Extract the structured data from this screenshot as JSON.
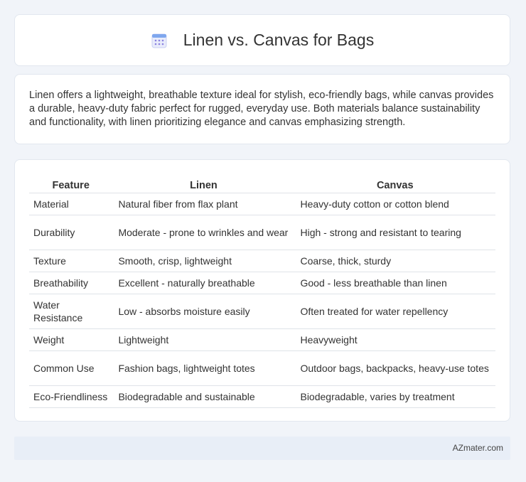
{
  "header": {
    "title": "Linen vs. Canvas for Bags",
    "icon": "calendar-icon"
  },
  "intro": {
    "text": "Linen offers a lightweight, breathable texture ideal for stylish, eco-friendly bags, while canvas provides a durable, heavy-duty fabric perfect for rugged, everyday use. Both materials balance sustainability and functionality, with linen prioritizing elegance and canvas emphasizing strength."
  },
  "table": {
    "headers": [
      "Feature",
      "Linen",
      "Canvas"
    ],
    "rows": [
      [
        "Material",
        "Natural fiber from flax plant",
        "Heavy-duty cotton or cotton blend"
      ],
      [
        "Durability",
        "Moderate - prone to wrinkles and wear",
        "High - strong and resistant to tearing"
      ],
      [
        "Texture",
        "Smooth, crisp, lightweight",
        "Coarse, thick, sturdy"
      ],
      [
        "Breathability",
        "Excellent - naturally breathable",
        "Good - less breathable than linen"
      ],
      [
        "Water Resistance",
        "Low - absorbs moisture easily",
        "Often treated for water repellency"
      ],
      [
        "Weight",
        "Lightweight",
        "Heavyweight"
      ],
      [
        "Common Use",
        "Fashion bags, lightweight totes",
        "Outdoor bags, backpacks, heavy-use totes"
      ],
      [
        "Eco-Friendliness",
        "Biodegradable and sustainable",
        "Biodegradable, varies by treatment"
      ]
    ]
  },
  "footer": {
    "text": "AZmater.com"
  },
  "colors": {
    "background": "#f1f4f9",
    "card": "#ffffff",
    "footer": "#e8eef7",
    "icon_accent": "#7b7fe0"
  }
}
